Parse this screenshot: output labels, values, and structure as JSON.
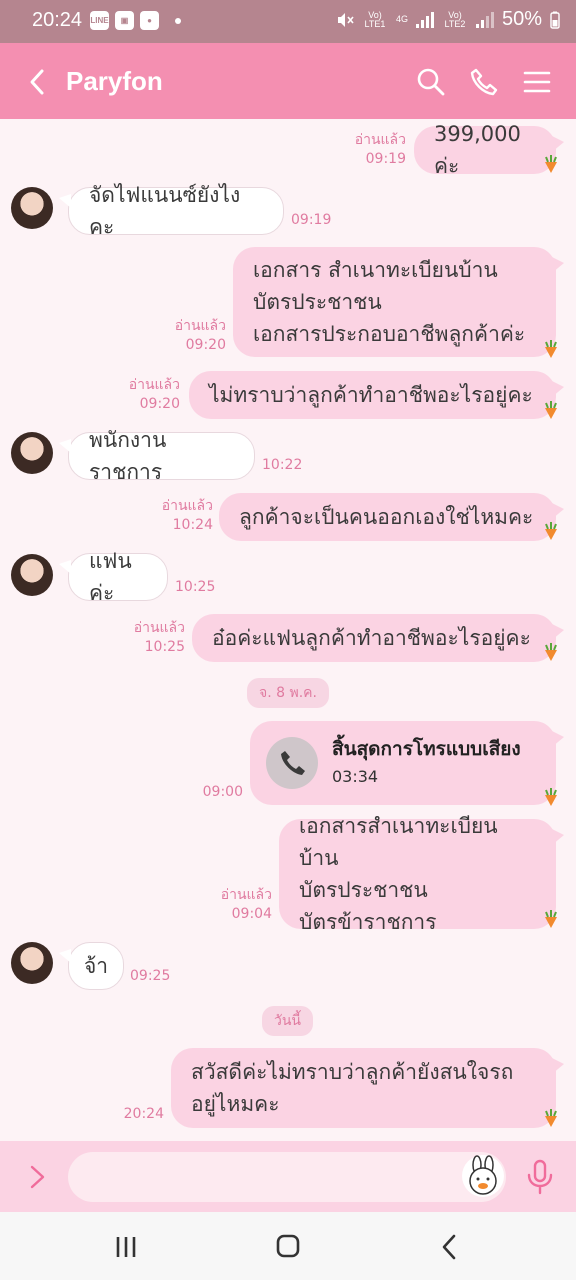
{
  "status_bar": {
    "time": "20:24",
    "sim1_label": "Vo) LTE1",
    "net_4g": "4G",
    "sim2_label": "Vo) LTE2",
    "battery": "50%",
    "left_icons": [
      "line-icon",
      "gallery-icon",
      "record-icon"
    ]
  },
  "header": {
    "title": "Paryfon",
    "icons": [
      "back-icon",
      "search-icon",
      "phone-icon",
      "menu-icon"
    ]
  },
  "messages": [
    {
      "dir": "out",
      "lines": [
        "399,000 ค่ะ"
      ],
      "read": "อ่านแล้ว",
      "time": "09:19"
    },
    {
      "dir": "in",
      "lines": [
        "จัดไฟแนนซ์ยังไงคะ"
      ],
      "time": "09:19"
    },
    {
      "dir": "out",
      "lines": [
        "เอกสาร สำเนาทะเบียนบ้าน",
        "บัตรประชาชน",
        "เอกสารประกอบอาชีพลูกค้าค่ะ"
      ],
      "read": "อ่านแล้ว",
      "time": "09:20"
    },
    {
      "dir": "out",
      "lines": [
        "ไม่ทราบว่าลูกค้าทำอาชีพอะไรอยู่คะ"
      ],
      "read": "อ่านแล้ว",
      "time": "09:20"
    },
    {
      "dir": "in",
      "lines": [
        "พนักงานราชการ"
      ],
      "time": "10:22"
    },
    {
      "dir": "out",
      "lines": [
        "ลูกค้าจะเป็นคนออกเองใช่ไหมคะ"
      ],
      "read": "อ่านแล้ว",
      "time": "10:24"
    },
    {
      "dir": "in",
      "lines": [
        "แฟนค่ะ"
      ],
      "time": "10:25"
    },
    {
      "dir": "out",
      "lines": [
        "อ๋อค่ะแฟนลูกค้าทำอาชีพอะไรอยู่คะ"
      ],
      "read": "อ่านแล้ว",
      "time": "10:25"
    },
    {
      "dir": "out",
      "lines": [
        "เอกสารสำเนาทะเบียนบ้าน",
        "บัตรประชาชน",
        "บัตรข้าราชการ"
      ],
      "read": "อ่านแล้ว",
      "time": "09:04"
    },
    {
      "dir": "in",
      "lines": [
        "จ้า"
      ],
      "time": "09:25"
    },
    {
      "dir": "out",
      "lines": [
        "สวัสดีค่ะไม่ทราบว่าลูกค้ายังสนใจรถ",
        "อยู่ไหมคะ"
      ],
      "time": "20:24"
    }
  ],
  "date_chips": [
    "จ. 8 พ.ค.",
    "วันนี้"
  ],
  "call": {
    "title": "สิ้นสุดการโทรแบบเสียง",
    "duration": "03:34",
    "time": "09:00"
  },
  "input": {
    "placeholder": ""
  },
  "colors": {
    "header": "#f48fb1",
    "bubble_out": "#fbd3e3",
    "meta_text": "#e07ba0",
    "chat_bg": "#fdf3f6"
  }
}
